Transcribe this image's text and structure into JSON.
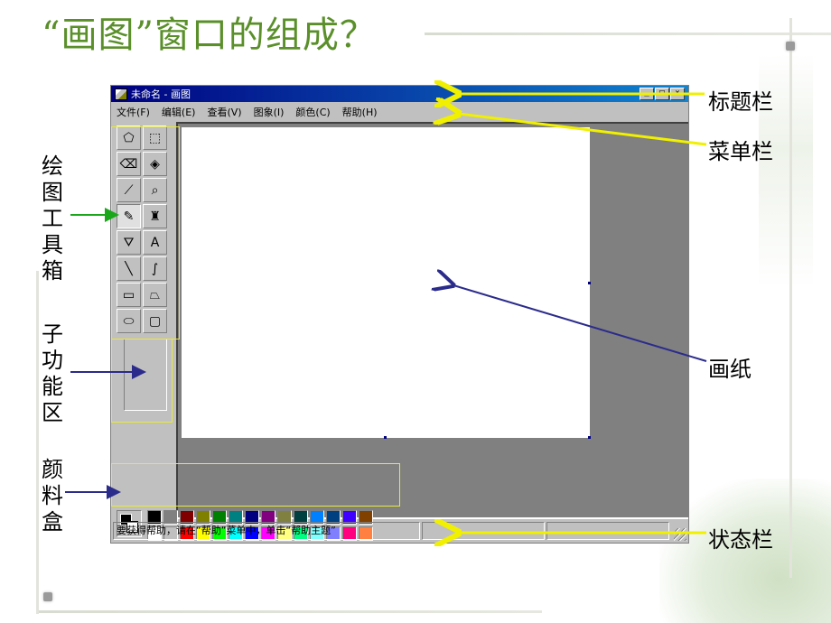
{
  "slide": {
    "title": "“画图”窗口的组成？"
  },
  "window": {
    "title": "未命名 - 画图",
    "menus": [
      "文件(F)",
      "编辑(E)",
      "查看(V)",
      "图象(I)",
      "颜色(C)",
      "帮助(H)"
    ],
    "status_text": "要获得帮助，请在“帮助”菜单中，单击“帮助主题”",
    "buttons": [
      "minimize",
      "maximize",
      "close"
    ]
  },
  "tools": [
    {
      "icon": "free-select-icon",
      "glyph": "⬠"
    },
    {
      "icon": "rect-select-icon",
      "glyph": "⬚"
    },
    {
      "icon": "eraser-icon",
      "glyph": "⌫"
    },
    {
      "icon": "fill-bucket-icon",
      "glyph": "◈"
    },
    {
      "icon": "color-picker-icon",
      "glyph": "⟋"
    },
    {
      "icon": "magnifier-icon",
      "glyph": "⌕"
    },
    {
      "icon": "pencil-icon",
      "glyph": "✎"
    },
    {
      "icon": "brush-icon",
      "glyph": "♜"
    },
    {
      "icon": "airbrush-icon",
      "glyph": "⛛"
    },
    {
      "icon": "text-icon",
      "glyph": "A"
    },
    {
      "icon": "line-icon",
      "glyph": "╲"
    },
    {
      "icon": "curve-icon",
      "glyph": "∫"
    },
    {
      "icon": "rectangle-icon",
      "glyph": "▭"
    },
    {
      "icon": "polygon-icon",
      "glyph": "⏢"
    },
    {
      "icon": "ellipse-icon",
      "glyph": "⬭"
    },
    {
      "icon": "rounded-rect-icon",
      "glyph": "▢"
    }
  ],
  "palette": {
    "foreground": "#000000",
    "background": "#ffffff",
    "colors": [
      "#000000",
      "#808080",
      "#800000",
      "#808000",
      "#008000",
      "#008080",
      "#000080",
      "#800080",
      "#808040",
      "#004040",
      "#0080ff",
      "#004080",
      "#4000ff",
      "#804000",
      "#ffffff",
      "#c0c0c0",
      "#ff0000",
      "#ffff00",
      "#00ff00",
      "#00ffff",
      "#0000ff",
      "#ff00ff",
      "#ffff80",
      "#00ff80",
      "#80ffff",
      "#8080ff",
      "#ff0080",
      "#ff8040"
    ]
  },
  "labels": {
    "title_bar": "标题栏",
    "menu_bar": "菜单栏",
    "toolbox": "绘图工具箱",
    "sub_function": "子功能区",
    "canvas": "画纸",
    "palette": "颜料盒",
    "status_bar": "状态栏"
  },
  "colors": {
    "title_green": "#5a8f2a",
    "arrow_yellow": "#f0f000",
    "arrow_blue": "#2b2b8c",
    "arrow_green": "#1aa81a"
  }
}
